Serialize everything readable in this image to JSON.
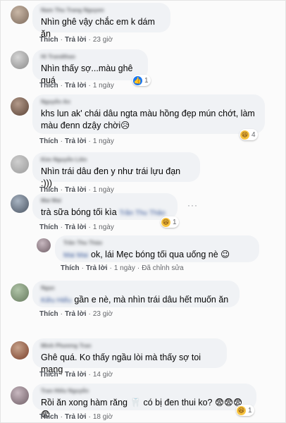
{
  "labels": {
    "like": "Thích",
    "reply": "Trả lời",
    "dot": "·",
    "edited": "Đã chỉnh sửa"
  },
  "comments": [
    {
      "author": "Nam Thu Trang Nguyen",
      "text": "Nhìn ghê vậy chắc em k dám ăn",
      "time": "23 giờ"
    },
    {
      "author": "Hi Trandthao",
      "text": "Nhìn thấy sợ...màu ghê quá",
      "time": "1 ngày",
      "reactions": {
        "icon": "like-icon",
        "count": "1"
      }
    },
    {
      "author": "Nguyễn An",
      "text": "khs lun ak' chái dâu ngta màu hồng đẹp mún chớt, làm màu đenn dzậy chời😥",
      "time": "1 ngày",
      "reactions": {
        "icon": "haha-icon",
        "count": "4"
      }
    },
    {
      "author": "Kim Nguyễn Liên",
      "text": "Nhìn trái dâu đen y như trái lựu đạn :)))",
      "time": "1 ngày"
    },
    {
      "author": "Mai Mai",
      "mention": "Trần Thu Thảo",
      "text": "trà sữa bóng tối kìa",
      "time": "1 ngày",
      "reactions": {
        "icon": "haha-icon",
        "count": "1"
      }
    },
    {
      "author": "Trần Thu Thảo",
      "mention": "Mai Mai",
      "text": "ok, lái Mẹc bóng tối qua uống nè 😉",
      "time": "1 ngày",
      "edited": true
    },
    {
      "author": "Ngọc",
      "mention": "Kiều Hiếu",
      "text": "gần e nè, mà nhìn trái dâu hết muốn ăn",
      "time": "23 giờ"
    },
    {
      "author": "Minh Phương Tran",
      "text": "Ghê quá. Ko thấy ngầu lòi mà thấy sợ toi mạng",
      "time": "14 giờ"
    },
    {
      "author": "Tran Hiếu Nguyễn",
      "text": "Rồi ăn xong hàm răng 🦷 có bị đen thui ko? 😨😨😨😨",
      "time": "18 giờ",
      "reactions": {
        "icon": "haha-icon",
        "count": "1"
      }
    }
  ]
}
